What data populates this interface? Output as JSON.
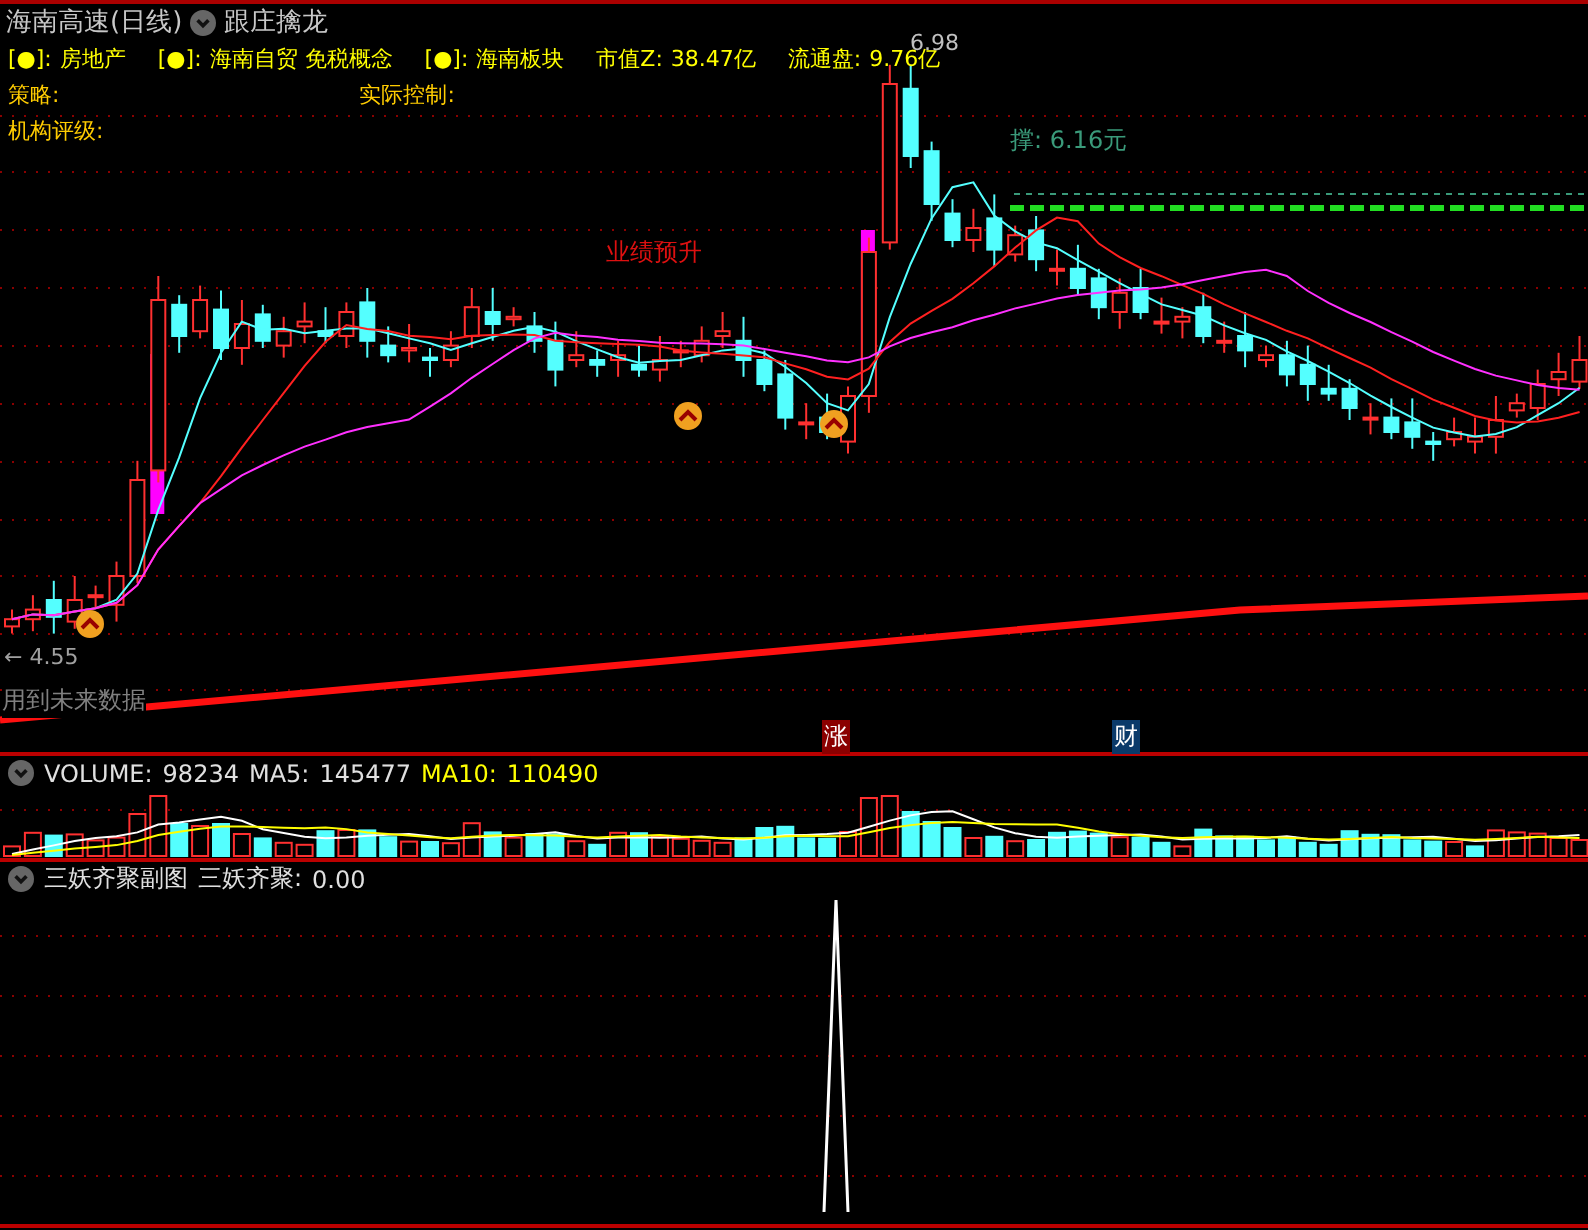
{
  "header": {
    "title": "海南高速(日线)",
    "indicator_name": "跟庄擒龙"
  },
  "info_rows": [
    [
      {
        "kind": "marker",
        "text": "[●]:"
      },
      {
        "kind": "value",
        "text": "房地产"
      },
      {
        "kind": "marker",
        "text": "[●]:"
      },
      {
        "kind": "value",
        "text": "海南自贸 免税概念"
      },
      {
        "kind": "marker",
        "text": "[●]:"
      },
      {
        "kind": "value",
        "text": "海南板块"
      },
      {
        "kind": "label",
        "text": "市值Z:"
      },
      {
        "kind": "value",
        "text": "38.47亿"
      },
      {
        "kind": "label",
        "text": "流通盘:"
      },
      {
        "kind": "value",
        "text": "9.76亿"
      }
    ],
    [
      {
        "kind": "label",
        "text": "策略:"
      },
      {
        "kind": "label",
        "text": "实际控制:"
      }
    ],
    [
      {
        "kind": "label",
        "text": "机构评级:"
      }
    ]
  ],
  "chart_labels": {
    "high": "6.98",
    "support": "撑: 6.16元",
    "event": "业绩预升",
    "low": "← 4.55",
    "warning": "用到未来数据"
  },
  "badges": [
    {
      "text": "涨",
      "color": "#8b0000"
    },
    {
      "text": "财",
      "color": "#0a3a6a"
    }
  ],
  "volume_header": [
    {
      "kind": "plain",
      "text": "VOLUME:"
    },
    {
      "kind": "plain",
      "text": "98234"
    },
    {
      "kind": "plain",
      "text": "MA5:"
    },
    {
      "kind": "plain",
      "text": "145477"
    },
    {
      "kind": "accent",
      "text": "MA10:"
    },
    {
      "kind": "accent",
      "text": "110490"
    }
  ],
  "indicator_header": {
    "name": "三妖齐聚副图",
    "label": "三妖齐聚:",
    "value": "0.00"
  }
}
